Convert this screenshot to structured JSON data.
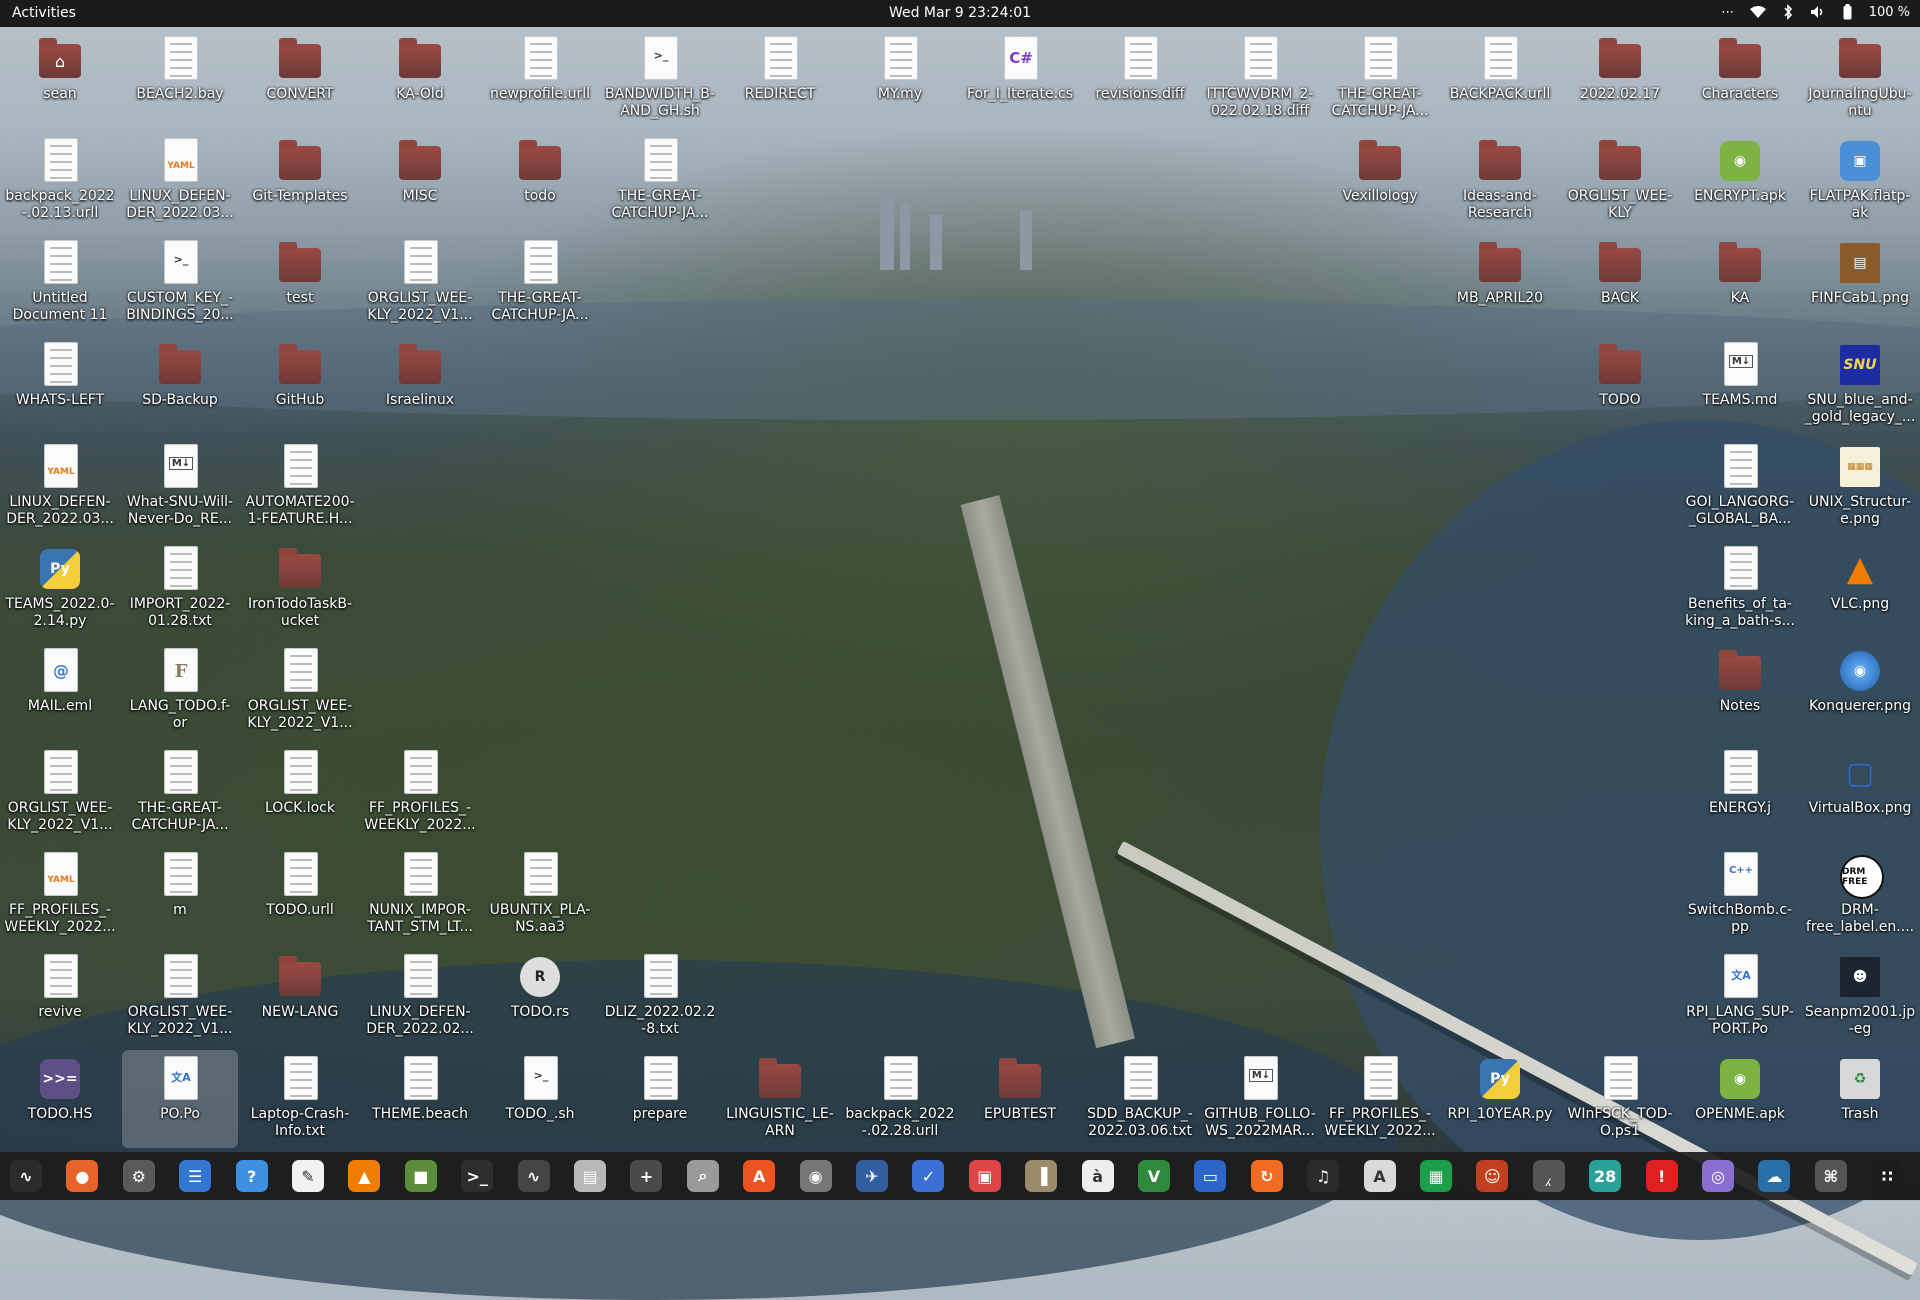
{
  "topbar": {
    "activities": "Activities",
    "clock": "Wed Mar 9  23:24:01",
    "battery": "100 %",
    "tray_icons": [
      "menu-dots-icon",
      "wifi-icon",
      "bluetooth-icon",
      "volume-icon",
      "battery-icon"
    ]
  },
  "desktop": {
    "icons": [
      {
        "label": "sean",
        "type": "home",
        "col": 0,
        "row": 0
      },
      {
        "label": "BEACH2.bay",
        "type": "doc",
        "col": 1,
        "row": 0
      },
      {
        "label": "CONVERT",
        "type": "folder",
        "col": 2,
        "row": 0
      },
      {
        "label": "KA-Old",
        "type": "folder",
        "col": 3,
        "row": 0
      },
      {
        "label": "newprofile.urll",
        "type": "doc",
        "col": 4,
        "row": 0
      },
      {
        "label": "BANDWIDTH_B-AND_GH.sh",
        "type": "script",
        "col": 5,
        "row": 0
      },
      {
        "label": "REDIRECT",
        "type": "doc",
        "col": 6,
        "row": 0
      },
      {
        "label": "MY.my",
        "type": "doc",
        "col": 7,
        "row": 0
      },
      {
        "label": "For_I_Iterate.cs",
        "type": "csharp",
        "col": 8,
        "row": 0
      },
      {
        "label": "revisions.diff",
        "type": "doc",
        "col": 9,
        "row": 0
      },
      {
        "label": "ITTCWVDRM_2-022.02.18.diff",
        "type": "doc",
        "col": 10,
        "row": 0
      },
      {
        "label": "THE-GREAT-CATCHUP-JA...",
        "type": "doc",
        "col": 11,
        "row": 0
      },
      {
        "label": "BACKPACK.urll",
        "type": "doc",
        "col": 12,
        "row": 0
      },
      {
        "label": "2022.02.17",
        "type": "folder",
        "col": 13,
        "row": 0
      },
      {
        "label": "Characters",
        "type": "folder",
        "col": 14,
        "row": 0
      },
      {
        "label": "JournalingUbu-ntu",
        "type": "folder",
        "col": 15,
        "row": 0
      },
      {
        "label": "backpack_2022-.02.13.urll",
        "type": "doc",
        "col": 0,
        "row": 1
      },
      {
        "label": "LINUX_DEFEN-DER_2022.03....",
        "type": "yaml",
        "col": 1,
        "row": 1
      },
      {
        "label": "Git-Templates",
        "type": "folder",
        "col": 2,
        "row": 1
      },
      {
        "label": "MISC",
        "type": "folder",
        "col": 3,
        "row": 1
      },
      {
        "label": "todo",
        "type": "folder",
        "col": 4,
        "row": 1
      },
      {
        "label": "THE-GREAT-CATCHUP-JA...",
        "type": "doc",
        "col": 5,
        "row": 1
      },
      {
        "label": "Vexillology",
        "type": "folder",
        "col": 11,
        "row": 1
      },
      {
        "label": "Ideas-and-Research",
        "type": "folder",
        "col": 12,
        "row": 1
      },
      {
        "label": "ORGLIST_WEE-KLY",
        "type": "folder",
        "col": 13,
        "row": 1
      },
      {
        "label": "ENCRYPT.apk",
        "type": "apk",
        "col": 14,
        "row": 1
      },
      {
        "label": "FLATPAK.flatp-ak",
        "type": "flatpak",
        "col": 15,
        "row": 1
      },
      {
        "label": "Untitled Document 11",
        "type": "doc",
        "col": 0,
        "row": 2
      },
      {
        "label": "CUSTOM_KEY_-BINDINGS_20...",
        "type": "script",
        "col": 1,
        "row": 2
      },
      {
        "label": "test",
        "type": "folder",
        "col": 2,
        "row": 2
      },
      {
        "label": "ORGLIST_WEE-KLY_2022_V1...",
        "type": "doc",
        "col": 3,
        "row": 2
      },
      {
        "label": "THE-GREAT-CATCHUP-JA...",
        "type": "doc",
        "col": 4,
        "row": 2
      },
      {
        "label": "MB_APRIL20",
        "type": "folder",
        "col": 12,
        "row": 2
      },
      {
        "label": "BACK",
        "type": "folder",
        "col": 13,
        "row": 2
      },
      {
        "label": "KA",
        "type": "folder",
        "col": 14,
        "row": 2
      },
      {
        "label": "FINFCab1.png",
        "type": "image-cabinet",
        "col": 15,
        "row": 2
      },
      {
        "label": "WHATS-LEFT",
        "type": "doc",
        "col": 0,
        "row": 3
      },
      {
        "label": "SD-Backup",
        "type": "folder",
        "col": 1,
        "row": 3
      },
      {
        "label": "GitHub",
        "type": "folder",
        "col": 2,
        "row": 3
      },
      {
        "label": "Israelinux",
        "type": "folder",
        "col": 3,
        "row": 3
      },
      {
        "label": "TODO",
        "type": "folder",
        "col": 13,
        "row": 3
      },
      {
        "label": "TEAMS.md",
        "type": "markdown",
        "col": 14,
        "row": 3
      },
      {
        "label": "SNU_blue_and-_gold_legacy_...",
        "type": "image-snu",
        "col": 15,
        "row": 3
      },
      {
        "label": "LINUX_DEFEN-DER_2022.03....",
        "type": "yaml",
        "col": 0,
        "row": 4
      },
      {
        "label": "What-SNU-Will-Never-Do_RE...",
        "type": "markdown",
        "col": 1,
        "row": 4
      },
      {
        "label": "AUTOMATE200-1-FEATURE.H...",
        "type": "doc",
        "col": 2,
        "row": 4
      },
      {
        "label": "GOI_LANGORG-_GLOBAL_BA...",
        "type": "doc",
        "col": 14,
        "row": 4
      },
      {
        "label": "UNIX_Structur-e.png",
        "type": "image-unix",
        "col": 15,
        "row": 4
      },
      {
        "label": "TEAMS_2022.0-2.14.py",
        "type": "python",
        "col": 0,
        "row": 5
      },
      {
        "label": "IMPORT_2022-01.28.txt",
        "type": "doc",
        "col": 1,
        "row": 5
      },
      {
        "label": "IronTodoTaskB-ucket",
        "type": "folder",
        "col": 2,
        "row": 5
      },
      {
        "label": "Benefits_of_ta-king_a_bath-s...",
        "type": "doc",
        "col": 14,
        "row": 5
      },
      {
        "label": "VLC.png",
        "type": "vlc",
        "col": 15,
        "row": 5
      },
      {
        "label": "MAIL.eml",
        "type": "mail",
        "col": 0,
        "row": 6
      },
      {
        "label": "LANG_TODO.f-or",
        "type": "fortran",
        "col": 1,
        "row": 6
      },
      {
        "label": "ORGLIST_WEE-KLY_2022_V1...",
        "type": "doc",
        "col": 2,
        "row": 6
      },
      {
        "label": "Notes",
        "type": "folder",
        "col": 14,
        "row": 6
      },
      {
        "label": "Konquerer.png",
        "type": "konqueror",
        "col": 15,
        "row": 6
      },
      {
        "label": "ORGLIST_WEE-KLY_2022_V1...",
        "type": "doc",
        "col": 0,
        "row": 7
      },
      {
        "label": "THE-GREAT-CATCHUP-JA...",
        "type": "doc",
        "col": 1,
        "row": 7
      },
      {
        "label": "LOCK.lock",
        "type": "doc",
        "col": 2,
        "row": 7
      },
      {
        "label": "FF_PROFILES_-WEEKLY_2022...",
        "type": "doc",
        "col": 3,
        "row": 7
      },
      {
        "label": "ENERGY.j",
        "type": "doc",
        "col": 14,
        "row": 7
      },
      {
        "label": "VirtualBox.png",
        "type": "virtualbox",
        "col": 15,
        "row": 7
      },
      {
        "label": "FF_PROFILES_-WEEKLY_2022...",
        "type": "yaml",
        "col": 0,
        "row": 8
      },
      {
        "label": "m",
        "type": "doc",
        "col": 1,
        "row": 8
      },
      {
        "label": "TODO.urll",
        "type": "doc",
        "col": 2,
        "row": 8
      },
      {
        "label": "NUNIX_IMPOR-TANT_STM_LT...",
        "type": "doc",
        "col": 3,
        "row": 8
      },
      {
        "label": "UBUNTIX_PLA-NS.aa3",
        "type": "doc",
        "col": 4,
        "row": 8
      },
      {
        "label": "SwitchBomb.c-pp",
        "type": "cpp",
        "col": 14,
        "row": 8
      },
      {
        "label": "DRM-free_label.en....",
        "type": "drm",
        "col": 15,
        "row": 8
      },
      {
        "label": "revive",
        "type": "doc",
        "col": 0,
        "row": 9
      },
      {
        "label": "ORGLIST_WEE-KLY_2022_V1...",
        "type": "doc",
        "col": 1,
        "row": 9
      },
      {
        "label": "NEW-LANG",
        "type": "folder",
        "col": 2,
        "row": 9
      },
      {
        "label": "LINUX_DEFEN-DER_2022.02....",
        "type": "doc",
        "col": 3,
        "row": 9
      },
      {
        "label": "TODO.rs",
        "type": "rust",
        "col": 4,
        "row": 9
      },
      {
        "label": "DLIZ_2022.02.2-8.txt",
        "type": "doc",
        "col": 5,
        "row": 9
      },
      {
        "label": "RPI_LANG_SUP-PORT.Po",
        "type": "po",
        "col": 14,
        "row": 9
      },
      {
        "label": "Seanpm2001.jp-eg",
        "type": "photo",
        "col": 15,
        "row": 9
      },
      {
        "label": "TODO.HS",
        "type": "haskell",
        "col": 0,
        "row": 10
      },
      {
        "label": "PO.Po",
        "type": "po",
        "col": 1,
        "row": 10,
        "selected": true
      },
      {
        "label": "Laptop-Crash-Info.txt",
        "type": "doc",
        "col": 2,
        "row": 10
      },
      {
        "label": "THEME.beach",
        "type": "doc",
        "col": 3,
        "row": 10
      },
      {
        "label": "TODO_.sh",
        "type": "script",
        "col": 4,
        "row": 10
      },
      {
        "label": "prepare",
        "type": "doc",
        "col": 5,
        "row": 10
      },
      {
        "label": "LINGUISTIC_LE-ARN",
        "type": "folder",
        "col": 6,
        "row": 10
      },
      {
        "label": "backpack_2022-.02.28.urll",
        "type": "doc",
        "col": 7,
        "row": 10
      },
      {
        "label": "EPUBTEST",
        "type": "folder",
        "col": 8,
        "row": 10
      },
      {
        "label": "SDD_BACKUP_-2022.03.06.txt",
        "type": "doc",
        "col": 9,
        "row": 10
      },
      {
        "label": "GITHUB_FOLLO-WS_2022MAR...",
        "type": "markdown",
        "col": 10,
        "row": 10
      },
      {
        "label": "FF_PROFILES_-WEEKLY_2022...",
        "type": "doc",
        "col": 11,
        "row": 10
      },
      {
        "label": "RPI_10YEAR.py",
        "type": "python",
        "col": 12,
        "row": 10
      },
      {
        "label": "WInFSCK_TOD-O.ps1",
        "type": "doc",
        "col": 13,
        "row": 10
      },
      {
        "label": "OPENME.apk",
        "type": "apk",
        "col": 14,
        "row": 10
      },
      {
        "label": "Trash",
        "type": "trash",
        "col": 15,
        "row": 10
      }
    ]
  },
  "dock": {
    "apps": [
      {
        "name": "system-monitor-icon",
        "glyph": "∿",
        "color": "#2b2b2b"
      },
      {
        "name": "firefox-icon",
        "glyph": "●",
        "color": "#e8632b"
      },
      {
        "name": "settings-icon",
        "glyph": "⚙",
        "color": "#5a5a5a"
      },
      {
        "name": "document-viewer-icon",
        "glyph": "☰",
        "color": "#3477d0"
      },
      {
        "name": "help-icon",
        "glyph": "?",
        "color": "#3d8fe0"
      },
      {
        "name": "text-editor-icon",
        "glyph": "✎",
        "color": "#f2f2f2"
      },
      {
        "name": "vlc-icon",
        "glyph": "▲",
        "color": "#ef7d00"
      },
      {
        "name": "minecraft-icon",
        "glyph": "■",
        "color": "#5b8d3b"
      },
      {
        "name": "terminal-icon",
        "glyph": ">_",
        "color": "#2e2e2e"
      },
      {
        "name": "graph-icon",
        "glyph": "∿",
        "color": "#444"
      },
      {
        "name": "files-icon",
        "glyph": "▤",
        "color": "#b8b8b8"
      },
      {
        "name": "calculator-icon",
        "glyph": "+",
        "color": "#4a4a4a"
      },
      {
        "name": "image-viewer-icon",
        "glyph": "⌕",
        "color": "#9a9a9a"
      },
      {
        "name": "software-center-icon",
        "glyph": "A",
        "color": "#e95420"
      },
      {
        "name": "chrome-icon",
        "glyph": "◉",
        "color": "#777"
      },
      {
        "name": "remmina-icon",
        "glyph": "✈",
        "color": "#315e9e"
      },
      {
        "name": "todo-icon",
        "glyph": "✓",
        "color": "#3b6fd6"
      },
      {
        "name": "screenshot-icon",
        "glyph": "▣",
        "color": "#d44"
      },
      {
        "name": "archive-icon",
        "glyph": "▐",
        "color": "#9b8b6b"
      },
      {
        "name": "characters-icon",
        "glyph": "à",
        "color": "#eee"
      },
      {
        "name": "vim-icon",
        "glyph": "V",
        "color": "#2f8a3d"
      },
      {
        "name": "screen-icon",
        "glyph": "▭",
        "color": "#2c66c8"
      },
      {
        "name": "update-icon",
        "glyph": "↻",
        "color": "#ef6c22"
      },
      {
        "name": "music-icon",
        "glyph": "♫",
        "color": "#2b2b2b"
      },
      {
        "name": "pdf-icon",
        "glyph": "A",
        "color": "#d9d9d9"
      },
      {
        "name": "spreadsheet-icon",
        "glyph": "▦",
        "color": "#1e9e4a"
      },
      {
        "name": "game-icon",
        "glyph": "☺",
        "color": "#c04020"
      },
      {
        "name": "cat-icon",
        "glyph": "⁁",
        "color": "#555"
      },
      {
        "name": "calendar-icon",
        "glyph": "28",
        "color": "#2aa198"
      },
      {
        "name": "alert-icon",
        "glyph": "!",
        "color": "#e02020"
      },
      {
        "name": "camera-icon",
        "glyph": "◎",
        "color": "#8a6fd0"
      },
      {
        "name": "weather-icon",
        "glyph": "☁",
        "color": "#2a6fa8"
      },
      {
        "name": "launcher-icon",
        "glyph": "⌘",
        "color": "#555"
      },
      {
        "name": "show-apps-icon",
        "glyph": "∷",
        "color": "#1c1c1c"
      }
    ]
  }
}
